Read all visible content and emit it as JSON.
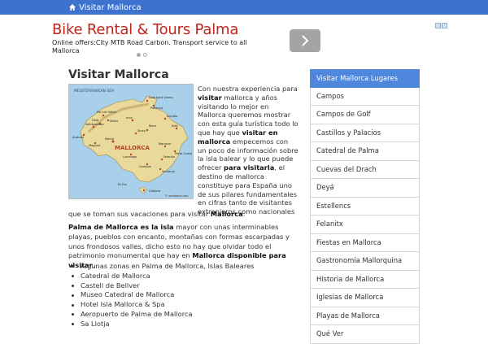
{
  "header": {
    "home_label": "Visitar Mallorca"
  },
  "ad": {
    "title": "Bike Rental & Tours Palma",
    "text": "Online offers:City MTB Road Carbon. Transport service to all Mallorca"
  },
  "main": {
    "title": "Visitar Mallorca",
    "map": {
      "sea_label": "MEDITERRANEAN SEA",
      "island_label": "MALLORCA",
      "watermark": "© worldatlas.com",
      "places": [
        "Cala Sant Vicenç",
        "Pollença",
        "Alcúdia",
        "Port de Sóller",
        "Sóller",
        "Valldemossa",
        "Deià",
        "Andratx",
        "Palma",
        "Manacor",
        "Inca",
        "Artà",
        "Santanyí",
        "Campos",
        "Felanitx",
        "Porto Cristo",
        "Llucmajor",
        "Magaluf",
        "Cabrera",
        "Es Pla",
        "Sineu",
        "Muro"
      ]
    },
    "intro_parts": [
      {
        "t": "Con nuestra experiencia para ",
        "b": false
      },
      {
        "t": "visitar",
        "b": true
      },
      {
        "t": " mallorca y años visitando lo mejor en Mallorca queremos mostrar con esta guía turística todo lo que hay que ",
        "b": false
      },
      {
        "t": "visitar en mallorca",
        "b": true
      },
      {
        "t": " empecemos con un poco de información sobre la isla balear y lo que puede ofrecer ",
        "b": false
      },
      {
        "t": "para visitarla",
        "b": true
      },
      {
        "t": ", el destino de mallorca constituye para España uno de sus pilares fundamentales en cifras tanto de visitantes extranjeros como nacionales",
        "b": false
      }
    ],
    "intro_tail_parts": [
      {
        "t": "que se toman sus vacaciones para visitar ",
        "b": false
      },
      {
        "t": "Mallorca",
        "b": true
      },
      {
        "t": ".",
        "b": false
      }
    ],
    "para2_parts": [
      {
        "t": "Palma de Mallorca es la isla",
        "b": true
      },
      {
        "t": " mayor con unas interminables playas, pueblos con encanto, montañas con formas escarpadas y unos frondosos valles, dicho esto no hay que olvidar todo el patrimonio monumental que hay en ",
        "b": false
      },
      {
        "t": "Mallorca disponible para visitar",
        "b": true
      },
      {
        "t": ".",
        "b": false
      }
    ],
    "bullets": [
      "Algunas zonas en Palma de Mallorca, Islas Baleares",
      "Catedral de Mallorca",
      "Castell de Bellver",
      "Museo Catedral de Mallorca",
      "Hotel Isla Mallorca & Spa",
      "Aeropuerto de Palma de Mallorca",
      "Sa Llotja"
    ]
  },
  "sidebar": {
    "items": [
      "Visitar Mallorca Lugares",
      "Campos",
      "Campos de Golf",
      "Castillos y Palacios",
      "Catedral de Palma",
      "Cuevas del Drach",
      "Deyá",
      "Estellencs",
      "Felanitx",
      "Fiestas en Mallorca",
      "Gastronomía Mallorquina",
      "Historia de Mallorca",
      "Iglesias de Mallorca",
      "Playas de Mallorca",
      "Qué Ver"
    ]
  },
  "colors": {
    "topbar": "#3d72cf",
    "ad_title": "#c1251c",
    "sidebar_active": "#4f87dc"
  }
}
